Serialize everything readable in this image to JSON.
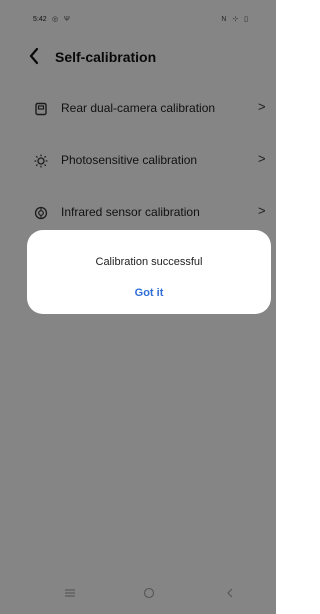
{
  "status_bar": {
    "time": "5:42",
    "left_icons": "◎ Ψ",
    "right_icons": "N ⊹ ▯"
  },
  "header": {
    "back_icon": "chevron-left-icon",
    "title": "Self-calibration"
  },
  "list": {
    "items": [
      {
        "icon": "camera-icon",
        "label": "Rear dual-camera calibration",
        "chevron": ">"
      },
      {
        "icon": "sun-icon",
        "label": "Photosensitive calibration",
        "chevron": ">"
      },
      {
        "icon": "infrared-icon",
        "label": "Infrared sensor calibration",
        "chevron": ">"
      }
    ]
  },
  "dialog": {
    "message": "Calibration successful",
    "button_label": "Got it"
  },
  "nav_bar": {
    "icons": [
      "menu-icon",
      "home-icon",
      "back-icon"
    ]
  },
  "colors": {
    "background": "#f2f2f2",
    "accent": "#2f6fd6",
    "overlay": "rgba(0,0,0,0.45)",
    "dialog_bg": "#ffffff"
  }
}
